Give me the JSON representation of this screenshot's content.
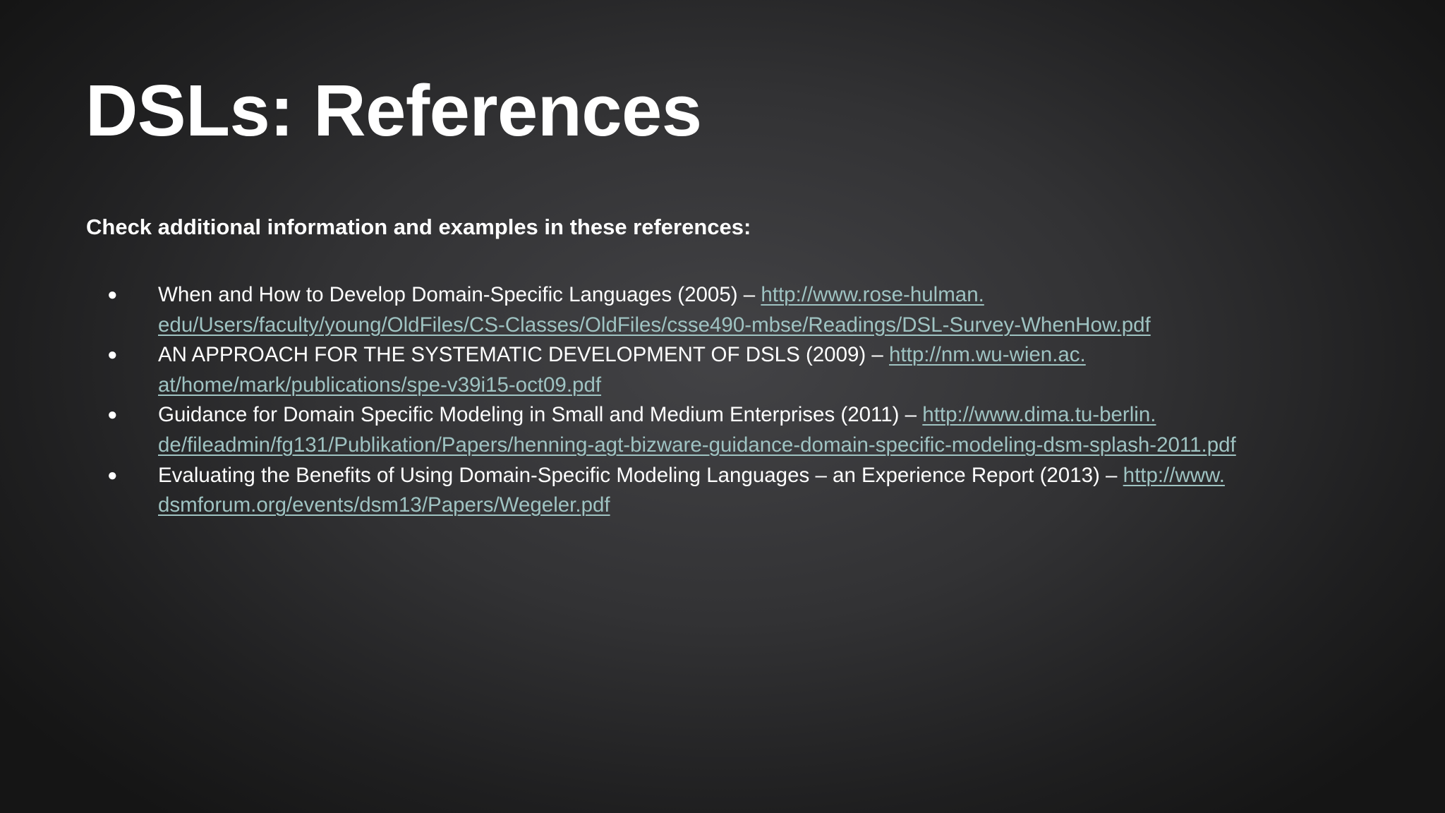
{
  "slide": {
    "title": "DSLs: References",
    "intro": "Check additional information and examples in these references:",
    "bullet_glyph": "●",
    "link_color": "#9fc3c2",
    "references": [
      {
        "text": "When and How to Develop Domain-Specific Languages (2005) – ",
        "link_part1": "http://www.rose-hulman.",
        "link_part2": "edu/Users/faculty/young/OldFiles/CS-Classes/OldFiles/csse490-mbse/Readings/DSL-Survey-WhenHow.pdf"
      },
      {
        "text": "AN APPROACH FOR THE SYSTEMATIC DEVELOPMENT OF DSLS (2009) – ",
        "link_part1": "http://nm.wu-wien.ac.",
        "link_part2": "at/home/mark/publications/spe-v39i15-oct09.pdf"
      },
      {
        "text": "Guidance for Domain Specific Modeling in Small and Medium Enterprises (2011) – ",
        "link_part1": "http://www.dima.tu-berlin.",
        "link_part2": "de/fileadmin/fg131/Publikation/Papers/henning-agt-bizware-guidance-domain-specific-modeling-dsm-splash-2011.pdf"
      },
      {
        "text": "Evaluating the Benefits of Using Domain-Specific Modeling Languages – an Experience Report (2013) – ",
        "link_part1": "http://www.",
        "link_part2": "dsmforum.org/events/dsm13/Papers/Wegeler.pdf"
      }
    ]
  }
}
